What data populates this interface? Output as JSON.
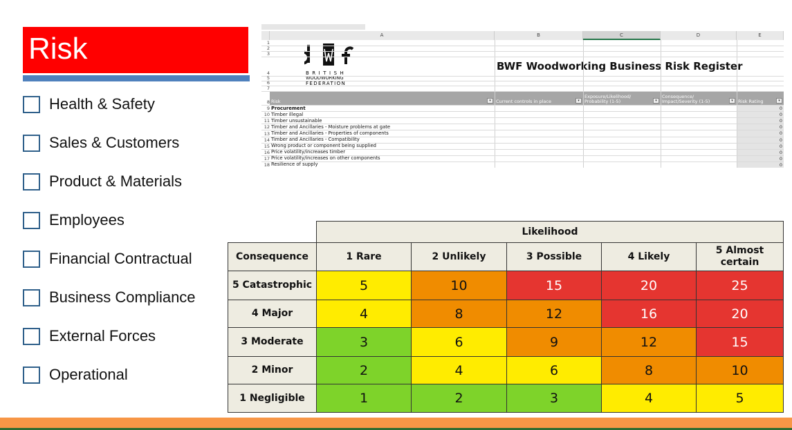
{
  "slide": {
    "title": "Risk",
    "categories": [
      "Health & Safety",
      "Sales & Customers",
      "Product & Materials",
      "Employees",
      "Financial Contractual",
      "Business Compliance",
      "External Forces",
      "Operational"
    ]
  },
  "spreadsheet": {
    "columns": [
      "A",
      "B",
      "C",
      "D",
      "E"
    ],
    "row_numbers": [
      "1",
      "2",
      "3",
      "4",
      "5",
      "6",
      "7",
      "8",
      "9",
      "10",
      "11",
      "12",
      "13",
      "14",
      "15",
      "16",
      "17",
      "18"
    ],
    "logo_text": "bwf",
    "logo_sub": [
      "BRITISH",
      "WOODWORKING",
      "FEDERATION"
    ],
    "title": "BWF Woodworking Business Risk Register",
    "headers": [
      "Risk",
      "Current controls in place",
      "Exposure/Likelihood/ Probability (1-5)",
      "Consequence/ Impact/Severity (1-5)",
      "Risk Rating"
    ],
    "rows": [
      {
        "risk": "Procurement",
        "bold": true,
        "rating": "0"
      },
      {
        "risk": "Timber illegal",
        "rating": "0"
      },
      {
        "risk": "Timber unsustainable",
        "rating": "0"
      },
      {
        "risk": "Timber and Ancillaries  - Moisture problems at gate",
        "rating": "0"
      },
      {
        "risk": "Timber and Ancillaries - Properties of components",
        "rating": "0"
      },
      {
        "risk": "Timber and Ancillaries  - Compatibility",
        "rating": "0"
      },
      {
        "risk": "Wrong product or component being supplied",
        "rating": "0"
      },
      {
        "risk": "Price volatility/increases timber",
        "rating": "0"
      },
      {
        "risk": "Price volatility/increases on other components",
        "rating": "0"
      },
      {
        "risk": "Resilience of supply",
        "rating": "0"
      }
    ]
  },
  "matrix": {
    "likelihood_label": "Likelihood",
    "consequence_label": "Consequence",
    "likelihood": [
      "1 Rare",
      "2 Unlikely",
      "3 Possible",
      "4 Likely",
      "5 Almost certain"
    ],
    "consequence": [
      "5 Catastrophic",
      "4 Major",
      "3 Moderate",
      "2 Minor",
      "1 Negligible"
    ],
    "values": [
      [
        "5",
        "10",
        "15",
        "20",
        "25"
      ],
      [
        "4",
        "8",
        "12",
        "16",
        "20"
      ],
      [
        "3",
        "6",
        "9",
        "12",
        "15"
      ],
      [
        "2",
        "4",
        "6",
        "8",
        "10"
      ],
      [
        "1",
        "2",
        "3",
        "4",
        "5"
      ]
    ],
    "colors": {
      "green": "#7ed32a",
      "yellow": "#ffec00",
      "orange": "#f08c00",
      "red": "#e53530"
    }
  }
}
